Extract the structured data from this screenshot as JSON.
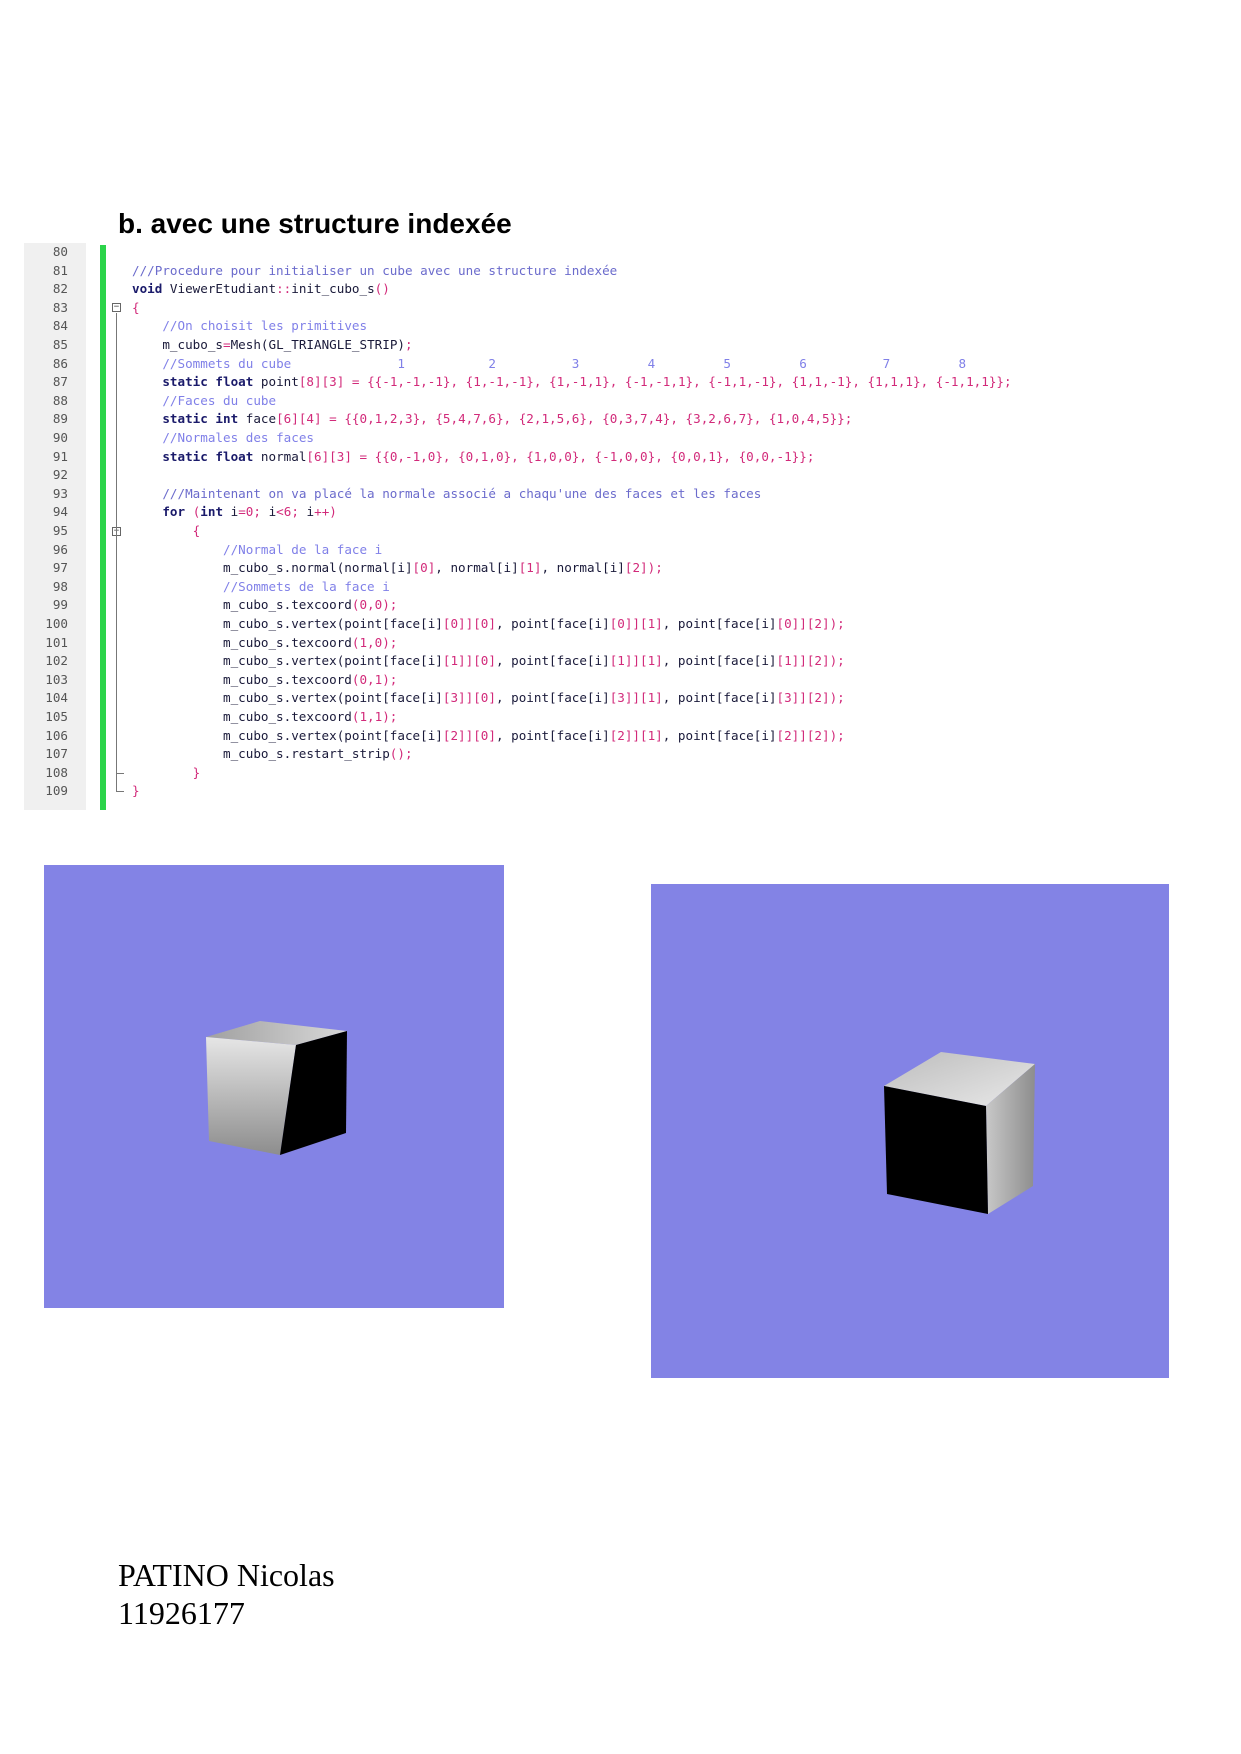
{
  "section_title": "b. avec une structure indexée",
  "code": {
    "lines": [
      {
        "n": "80",
        "t": [
          {
            "c": "plain",
            "s": ""
          }
        ]
      },
      {
        "n": "81",
        "t": [
          {
            "c": "doc",
            "s": "///Procedure pour initialiser un cube avec une structure indexée"
          }
        ]
      },
      {
        "n": "82",
        "t": [
          {
            "c": "keyword",
            "s": "void"
          },
          {
            "c": "plain",
            "s": " ViewerEtudiant"
          },
          {
            "c": "op",
            "s": "::"
          },
          {
            "c": "plain",
            "s": "init_cubo_s"
          },
          {
            "c": "op",
            "s": "()"
          }
        ]
      },
      {
        "n": "83",
        "t": [
          {
            "c": "op",
            "s": "{"
          }
        ]
      },
      {
        "n": "84",
        "t": [
          {
            "c": "plain",
            "s": "    "
          },
          {
            "c": "comment",
            "s": "//On choisit les primitives"
          }
        ]
      },
      {
        "n": "85",
        "t": [
          {
            "c": "plain",
            "s": "    m_cubo_s"
          },
          {
            "c": "op",
            "s": "="
          },
          {
            "c": "plain",
            "s": "Mesh(GL_TRIANGLE_STRIP)"
          },
          {
            "c": "op",
            "s": ";"
          }
        ]
      },
      {
        "n": "86",
        "t": [
          {
            "c": "plain",
            "s": "    "
          },
          {
            "c": "comment",
            "s": "//Sommets du cube              1           2          3         4         5         6          7         8"
          }
        ]
      },
      {
        "n": "87",
        "t": [
          {
            "c": "plain",
            "s": "    "
          },
          {
            "c": "keyword",
            "s": "static float"
          },
          {
            "c": "plain",
            "s": " point"
          },
          {
            "c": "number",
            "s": "[8][3] = {{-1,-1,-1}, {1,-1,-1}, {1,-1,1}, {-1,-1,1}, {-1,1,-1}, {1,1,-1}, {1,1,1}, {-1,1,1}};"
          }
        ]
      },
      {
        "n": "88",
        "t": [
          {
            "c": "plain",
            "s": "    "
          },
          {
            "c": "comment",
            "s": "//Faces du cube"
          }
        ]
      },
      {
        "n": "89",
        "t": [
          {
            "c": "plain",
            "s": "    "
          },
          {
            "c": "keyword",
            "s": "static int"
          },
          {
            "c": "plain",
            "s": " face"
          },
          {
            "c": "number",
            "s": "[6][4] = {{0,1,2,3}, {5,4,7,6}, {2,1,5,6}, {0,3,7,4}, {3,2,6,7}, {1,0,4,5}};"
          }
        ]
      },
      {
        "n": "90",
        "t": [
          {
            "c": "plain",
            "s": "    "
          },
          {
            "c": "comment",
            "s": "//Normales des faces"
          }
        ]
      },
      {
        "n": "91",
        "t": [
          {
            "c": "plain",
            "s": "    "
          },
          {
            "c": "keyword",
            "s": "static float"
          },
          {
            "c": "plain",
            "s": " normal"
          },
          {
            "c": "number",
            "s": "[6][3] = {{0,-1,0}, {0,1,0}, {1,0,0}, {-1,0,0}, {0,0,1}, {0,0,-1}};"
          }
        ]
      },
      {
        "n": "92",
        "t": [
          {
            "c": "plain",
            "s": ""
          }
        ]
      },
      {
        "n": "93",
        "t": [
          {
            "c": "plain",
            "s": "    "
          },
          {
            "c": "doc",
            "s": "///Maintenant on va placé la normale associé a chaqu'une des faces et les faces"
          }
        ]
      },
      {
        "n": "94",
        "t": [
          {
            "c": "plain",
            "s": "    "
          },
          {
            "c": "keyword",
            "s": "for"
          },
          {
            "c": "plain",
            "s": " "
          },
          {
            "c": "op",
            "s": "("
          },
          {
            "c": "keyword",
            "s": "int"
          },
          {
            "c": "plain",
            "s": " i"
          },
          {
            "c": "op",
            "s": "="
          },
          {
            "c": "number",
            "s": "0"
          },
          {
            "c": "op",
            "s": ";"
          },
          {
            "c": "plain",
            "s": " i"
          },
          {
            "c": "op",
            "s": "<"
          },
          {
            "c": "number",
            "s": "6"
          },
          {
            "c": "op",
            "s": ";"
          },
          {
            "c": "plain",
            "s": " i"
          },
          {
            "c": "op",
            "s": "++)"
          }
        ]
      },
      {
        "n": "95",
        "t": [
          {
            "c": "plain",
            "s": "        "
          },
          {
            "c": "op",
            "s": "{"
          }
        ]
      },
      {
        "n": "96",
        "t": [
          {
            "c": "plain",
            "s": "            "
          },
          {
            "c": "comment",
            "s": "//Normal de la face i"
          }
        ]
      },
      {
        "n": "97",
        "t": [
          {
            "c": "plain",
            "s": "            m_cubo_s.normal(normal[i]"
          },
          {
            "c": "number",
            "s": "[0]"
          },
          {
            "c": "plain",
            "s": ", normal[i]"
          },
          {
            "c": "number",
            "s": "[1]"
          },
          {
            "c": "plain",
            "s": ", normal[i]"
          },
          {
            "c": "number",
            "s": "[2]"
          },
          {
            "c": "op",
            "s": ");"
          }
        ]
      },
      {
        "n": "98",
        "t": [
          {
            "c": "plain",
            "s": "            "
          },
          {
            "c": "comment",
            "s": "//Sommets de la face i"
          }
        ]
      },
      {
        "n": "99",
        "t": [
          {
            "c": "plain",
            "s": "            m_cubo_s.texcoord"
          },
          {
            "c": "number",
            "s": "(0,0);"
          }
        ]
      },
      {
        "n": "100",
        "t": [
          {
            "c": "plain",
            "s": "            m_cubo_s.vertex(point[face[i]"
          },
          {
            "c": "number",
            "s": "[0]][0]"
          },
          {
            "c": "plain",
            "s": ", point[face[i]"
          },
          {
            "c": "number",
            "s": "[0]][1]"
          },
          {
            "c": "plain",
            "s": ", point[face[i]"
          },
          {
            "c": "number",
            "s": "[0]][2]);"
          }
        ]
      },
      {
        "n": "101",
        "t": [
          {
            "c": "plain",
            "s": "            m_cubo_s.texcoord"
          },
          {
            "c": "number",
            "s": "(1,0);"
          }
        ]
      },
      {
        "n": "102",
        "t": [
          {
            "c": "plain",
            "s": "            m_cubo_s.vertex(point[face[i]"
          },
          {
            "c": "number",
            "s": "[1]][0]"
          },
          {
            "c": "plain",
            "s": ", point[face[i]"
          },
          {
            "c": "number",
            "s": "[1]][1]"
          },
          {
            "c": "plain",
            "s": ", point[face[i]"
          },
          {
            "c": "number",
            "s": "[1]][2]);"
          }
        ]
      },
      {
        "n": "103",
        "t": [
          {
            "c": "plain",
            "s": "            m_cubo_s.texcoord"
          },
          {
            "c": "number",
            "s": "(0,1);"
          }
        ]
      },
      {
        "n": "104",
        "t": [
          {
            "c": "plain",
            "s": "            m_cubo_s.vertex(point[face[i]"
          },
          {
            "c": "number",
            "s": "[3]][0]"
          },
          {
            "c": "plain",
            "s": ", point[face[i]"
          },
          {
            "c": "number",
            "s": "[3]][1]"
          },
          {
            "c": "plain",
            "s": ", point[face[i]"
          },
          {
            "c": "number",
            "s": "[3]][2]);"
          }
        ]
      },
      {
        "n": "105",
        "t": [
          {
            "c": "plain",
            "s": "            m_cubo_s.texcoord"
          },
          {
            "c": "number",
            "s": "(1,1);"
          }
        ]
      },
      {
        "n": "106",
        "t": [
          {
            "c": "plain",
            "s": "            m_cubo_s.vertex(point[face[i]"
          },
          {
            "c": "number",
            "s": "[2]][0]"
          },
          {
            "c": "plain",
            "s": ", point[face[i]"
          },
          {
            "c": "number",
            "s": "[2]][1]"
          },
          {
            "c": "plain",
            "s": ", point[face[i]"
          },
          {
            "c": "number",
            "s": "[2]][2]);"
          }
        ]
      },
      {
        "n": "107",
        "t": [
          {
            "c": "plain",
            "s": "            m_cubo_s.restart_strip"
          },
          {
            "c": "op",
            "s": "();"
          }
        ]
      },
      {
        "n": "108",
        "t": [
          {
            "c": "plain",
            "s": "        "
          },
          {
            "c": "op",
            "s": "}"
          }
        ]
      },
      {
        "n": "109",
        "t": [
          {
            "c": "op",
            "s": "}"
          }
        ]
      }
    ]
  },
  "viewport_color": "#8383e5",
  "cube_colors": {
    "light": "#e0e0e0",
    "mid": "#9a9a9a",
    "dark": "#000000"
  },
  "author": {
    "name": "PATINO Nicolas",
    "student_id": "11926177"
  }
}
